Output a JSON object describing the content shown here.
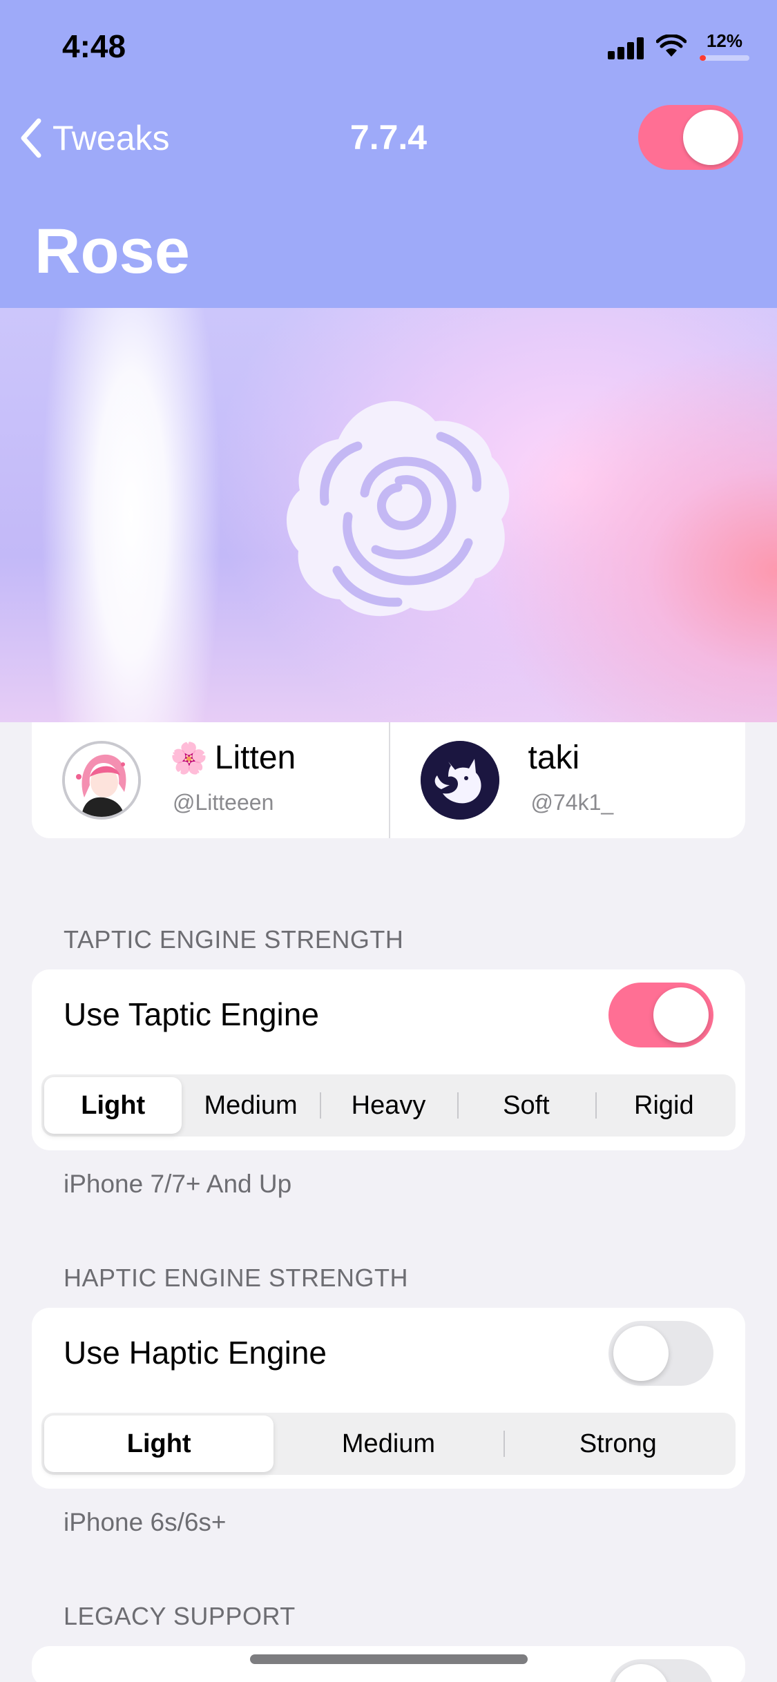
{
  "status_bar": {
    "time": "4:48",
    "battery_text": "12%",
    "battery_level": 0.12,
    "icons": [
      "signal-icon",
      "wifi-icon",
      "battery-icon"
    ]
  },
  "nav": {
    "back_label": "Tweaks",
    "version": "7.7.4",
    "enabled": true
  },
  "page": {
    "title": "Rose"
  },
  "banner": {
    "icon": "rose-icon"
  },
  "credits": [
    {
      "emoji": "🌸",
      "name": "Litten",
      "handle": "@Litteeen"
    },
    {
      "name": "taki",
      "handle": "@74k1_"
    }
  ],
  "taptic": {
    "header": "TAPTIC ENGINE STRENGTH",
    "toggle_label": "Use Taptic Engine",
    "toggle_on": true,
    "options": [
      "Light",
      "Medium",
      "Heavy",
      "Soft",
      "Rigid"
    ],
    "selected": "Light",
    "footer": "iPhone 7/7+ And Up"
  },
  "haptic": {
    "header": "HAPTIC ENGINE STRENGTH",
    "toggle_label": "Use Haptic Engine",
    "toggle_on": false,
    "options": [
      "Light",
      "Medium",
      "Strong"
    ],
    "selected": "Light",
    "footer": "iPhone 6s/6s+"
  },
  "legacy": {
    "header": "LEGACY SUPPORT"
  },
  "colors": {
    "header_bg": "#9eaaf9",
    "accent_pink": "#ff6f94",
    "group_bg": "#f2f1f6"
  }
}
